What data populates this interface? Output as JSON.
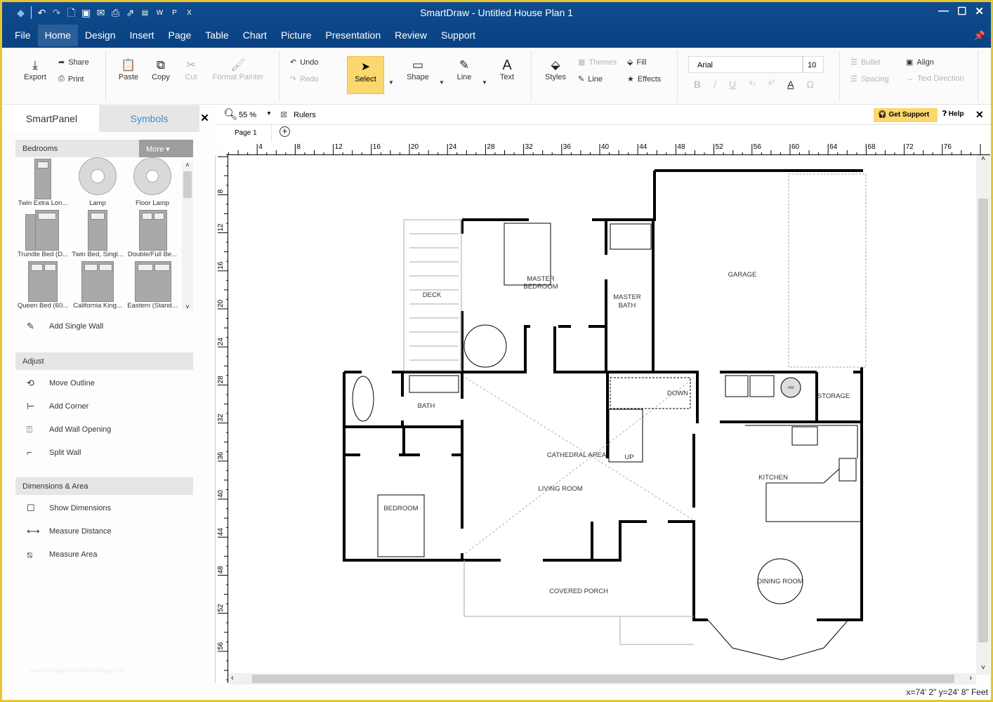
{
  "window": {
    "title": "SmartDraw - Untitled House Plan 1",
    "controls": [
      "minimize",
      "maximize",
      "close"
    ]
  },
  "quick_access": [
    "app-logo-icon",
    "undo-icon",
    "redo-icon",
    "new-doc-icon",
    "save-icon",
    "email-icon",
    "print-icon",
    "share-icon",
    "pdf-icon",
    "word-icon",
    "powerpoint-icon",
    "excel-icon"
  ],
  "menu": {
    "items": [
      "File",
      "Home",
      "Design",
      "Insert",
      "Page",
      "Table",
      "Chart",
      "Picture",
      "Presentation",
      "Review",
      "Support"
    ],
    "active": "Home"
  },
  "ribbon": {
    "export": "Export",
    "share": "Share",
    "print": "Print",
    "paste": "Paste",
    "copy": "Copy",
    "cut": "Cut",
    "format_painter": "Format Painter",
    "undo": "Undo",
    "redo": "Redo",
    "select": "Select",
    "shape": "Shape",
    "line": "Line",
    "text": "Text",
    "styles": "Styles",
    "themes": "Themes",
    "line_style": "Line",
    "fill": "Fill",
    "effects": "Effects",
    "font": "Arial",
    "font_size": "10",
    "bullet": "Bullet",
    "spacing": "Spacing",
    "align": "Align",
    "text_direction": "Text Direction",
    "format_buttons": [
      "B",
      "/",
      "U",
      "x₂",
      "x²",
      "A",
      "Ω"
    ]
  },
  "panel": {
    "tabs": {
      "smartpanel": "SmartPanel",
      "symbols": "Symbols",
      "active": "Symbols"
    },
    "library": "Bedrooms",
    "more": "More",
    "symbols": [
      "Twin Extra Lon...",
      "Lamp",
      "Floor Lamp",
      "Trundle Bed (D...",
      "Twin Bed, Singl...",
      "Double/Full Be...",
      "Queen Bed (60...",
      "California King...",
      "Eastern (Stand..."
    ],
    "add_single_wall": "Add Single Wall",
    "adjust": {
      "title": "Adjust",
      "items": [
        "Move Outline",
        "Add Corner",
        "Add Wall Opening",
        "Split Wall"
      ]
    },
    "dimensions": {
      "title": "Dimensions & Area",
      "items": [
        "Show Dimensions",
        "Measure Distance",
        "Measure Area"
      ]
    }
  },
  "canvas_toolbar": {
    "zoom": "55 %",
    "rulers": "Rulers",
    "get_support": "Get Support",
    "help": "Help"
  },
  "pages": {
    "current": "Page 1"
  },
  "rulers": {
    "horizontal": [
      "4",
      "8",
      "12",
      "16",
      "20",
      "24",
      "28",
      "32",
      "36",
      "40",
      "44",
      "48",
      "52",
      "56",
      "60",
      "64",
      "68",
      "72",
      "76"
    ],
    "vertical": [
      "8",
      "12",
      "16",
      "20",
      "24",
      "28",
      "32",
      "36",
      "40",
      "44",
      "48",
      "52",
      "56"
    ]
  },
  "floorplan": {
    "rooms": [
      "DECK",
      "MASTER BEDROOM",
      "MASTER BATH",
      "GARAGE",
      "BATH",
      "CATHEDRAL AREA",
      "LIVING ROOM",
      "DOWN",
      "UP",
      "STORAGE",
      "KITCHEN",
      "BEDROOM",
      "DINING ROOM",
      "COVERED PORCH",
      "HW"
    ]
  },
  "status": {
    "coords": "x=74' 2\"  y=24' 8\" Feet"
  },
  "watermark": "www.heritagechristiancollege.com"
}
